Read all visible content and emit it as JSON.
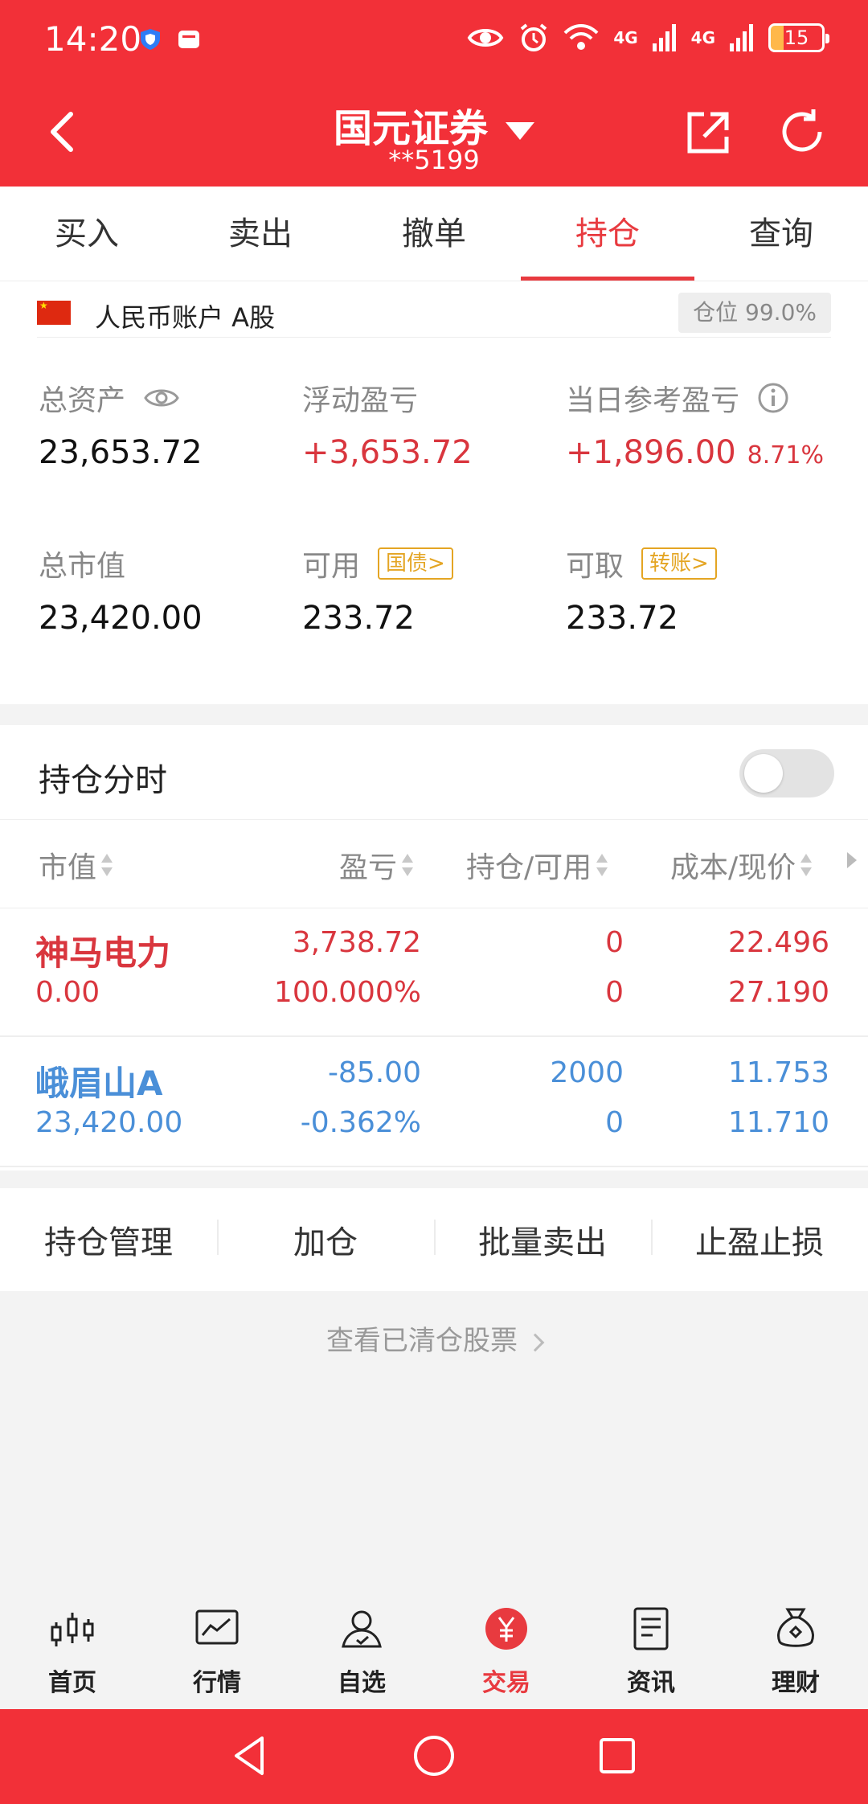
{
  "status": {
    "time": "14:20",
    "net1": "4G",
    "net2": "4G",
    "battery": "15"
  },
  "header": {
    "title": "国元证券",
    "subtitle": "**5199"
  },
  "tabs": [
    "买入",
    "卖出",
    "撤单",
    "持仓",
    "查询"
  ],
  "active_tab": "持仓",
  "account": {
    "label": "人民币账户 A股",
    "position_badge": "仓位 99.0%",
    "total_assets_label": "总资产",
    "total_assets": "23,653.72",
    "float_pnl_label": "浮动盈亏",
    "float_pnl": "+3,653.72",
    "day_pnl_label": "当日参考盈亏",
    "day_pnl": "+1,896.00",
    "day_pnl_pct": "8.71%",
    "market_value_label": "总市值",
    "market_value": "23,420.00",
    "available_label": "可用",
    "available_tag": "国债>",
    "available": "233.72",
    "withdrawable_label": "可取",
    "withdrawable_tag": "转账>",
    "withdrawable": "233.72"
  },
  "holdings": {
    "title": "持仓分时",
    "columns": [
      "市值",
      "盈亏",
      "持仓/可用",
      "成本/现价"
    ],
    "rows": [
      {
        "name": "神马电力",
        "market_value": "0.00",
        "pnl": "3,738.72",
        "pnl_pct": "100.000%",
        "hold": "0",
        "avail": "0",
        "cost": "22.496",
        "price": "27.190",
        "color": "#d9363e"
      },
      {
        "name": "峨眉山A",
        "market_value": "23,420.00",
        "pnl": "-85.00",
        "pnl_pct": "-0.362%",
        "hold": "2000",
        "avail": "0",
        "cost": "11.753",
        "price": "11.710",
        "color": "#4a8fd8"
      }
    ]
  },
  "actions": [
    "持仓管理",
    "加仓",
    "批量卖出",
    "止盈止损"
  ],
  "cleared_link": "查看已清仓股票",
  "bottom_nav": [
    "首页",
    "行情",
    "自选",
    "交易",
    "资讯",
    "理财"
  ],
  "bottom_nav_active": "交易",
  "colors": {
    "brand": "#f23038",
    "up": "#d9363e",
    "down": "#4a8fd8",
    "tag": "#e4a523"
  }
}
